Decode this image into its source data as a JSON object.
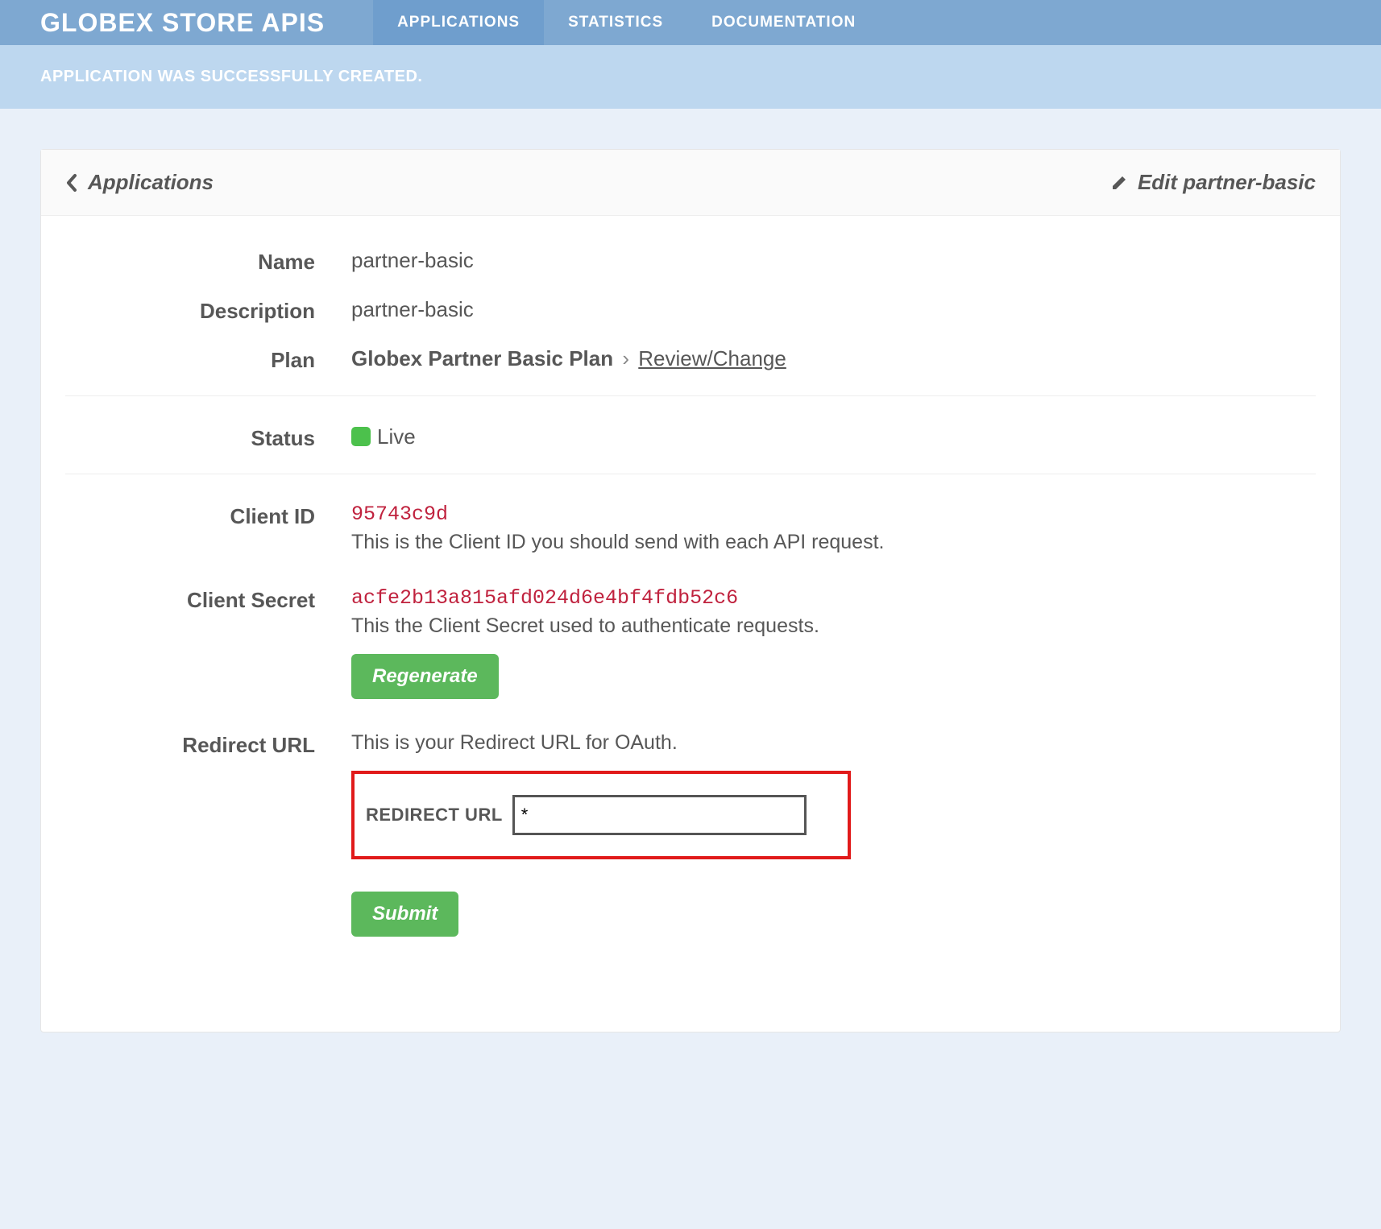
{
  "header": {
    "brand": "GLOBEX STORE APIS",
    "nav": {
      "applications": "APPLICATIONS",
      "statistics": "STATISTICS",
      "documentation": "DOCUMENTATION"
    }
  },
  "flash": "APPLICATION WAS SUCCESSFULLY CREATED.",
  "panel": {
    "back_label": "Applications",
    "edit_label": "Edit partner-basic"
  },
  "fields": {
    "name": {
      "label": "Name",
      "value": "partner-basic"
    },
    "description": {
      "label": "Description",
      "value": "partner-basic"
    },
    "plan": {
      "label": "Plan",
      "value": "Globex Partner Basic Plan",
      "sep": "›",
      "link": "Review/Change"
    },
    "status": {
      "label": "Status",
      "value": "Live"
    },
    "client_id": {
      "label": "Client ID",
      "value": "95743c9d",
      "hint": "This is the Client ID you should send with each API request."
    },
    "client_secret": {
      "label": "Client Secret",
      "value": "acfe2b13a815afd024d6e4bf4fdb52c6",
      "hint": "This the Client Secret used to authenticate requests.",
      "button": "Regenerate"
    },
    "redirect_url": {
      "label": "Redirect URL",
      "hint": "This is your Redirect URL for OAuth.",
      "input_label": "REDIRECT URL",
      "input_value": "*",
      "submit": "Submit"
    }
  }
}
